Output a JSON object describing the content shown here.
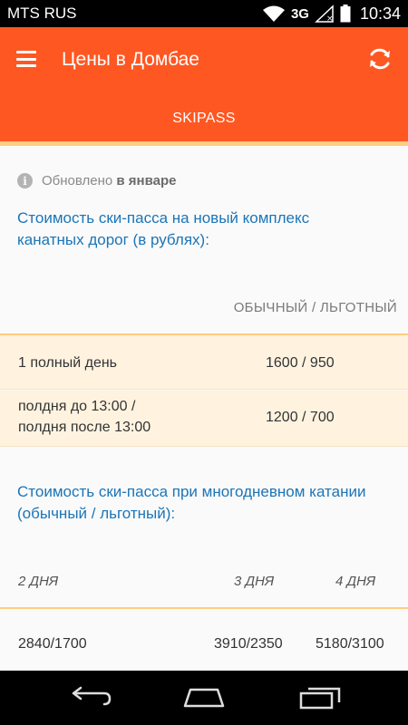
{
  "status": {
    "carrier": "MTS RUS",
    "network": "3G",
    "time": "10:34"
  },
  "appbar": {
    "title": "Цены в Домбае",
    "tab": "SKIPASS",
    "menu_icon": "menu-icon",
    "refresh_icon": "refresh-icon"
  },
  "updated": {
    "prefix": "Обновлено ",
    "bold": "в январе"
  },
  "section1": {
    "heading": "Стоимость ски-пасса на новый комплекс канатных дорог (в рублях):",
    "column_header": "ОБЫЧНЫЙ / ЛЬГОТНЫЙ",
    "rows": [
      {
        "label": "1 полный день",
        "value": "1600 / 950"
      },
      {
        "label1": "полдня до 13:00 /",
        "label2": "полдня после 13:00",
        "value": "1200 / 700"
      }
    ]
  },
  "section2": {
    "heading": "Стоимость ски-пасса при многодневном катании (обычный / льготный):",
    "days": [
      "2 ДНЯ",
      "3 ДНЯ",
      "4 ДНЯ"
    ],
    "prices": [
      "2840/1700",
      "3910/2350",
      "5180/3100"
    ]
  }
}
